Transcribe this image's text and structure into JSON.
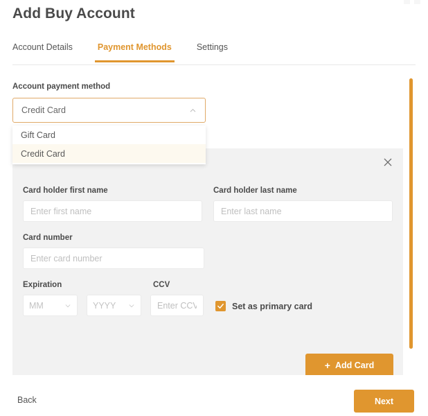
{
  "header": {
    "title": "Add Buy Account"
  },
  "tabs": [
    {
      "label": "Account Details",
      "active": false
    },
    {
      "label": "Payment Methods",
      "active": true
    },
    {
      "label": "Settings",
      "active": false
    }
  ],
  "payment_method": {
    "label": "Account payment method",
    "selected": "Credit Card",
    "expanded": true,
    "options": [
      {
        "label": "Gift Card",
        "selected": false
      },
      {
        "label": "Credit Card",
        "selected": true
      }
    ]
  },
  "card_panel": {
    "close_icon": "close-icon",
    "first_name": {
      "label": "Card holder first name",
      "placeholder": "Enter first name",
      "value": ""
    },
    "last_name": {
      "label": "Card holder last name",
      "placeholder": "Enter last name",
      "value": ""
    },
    "card_number": {
      "label": "Card number",
      "placeholder": "Enter card number",
      "value": ""
    },
    "expiration": {
      "label": "Expiration",
      "month": "MM",
      "year": "YYYY"
    },
    "ccv": {
      "label": "CCV",
      "placeholder": "Enter CCV",
      "value": ""
    },
    "primary_card": {
      "label": "Set as primary card",
      "checked": true
    },
    "add_card_button": {
      "label": "Add Card",
      "icon": "plus-icon"
    }
  },
  "footer": {
    "back_label": "Back",
    "next_label": "Next"
  },
  "colors": {
    "accent": "#e0962f",
    "panel_bg": "#f2f2f2",
    "option_highlight": "#fdf9ef",
    "text": "#4a4a4a"
  }
}
